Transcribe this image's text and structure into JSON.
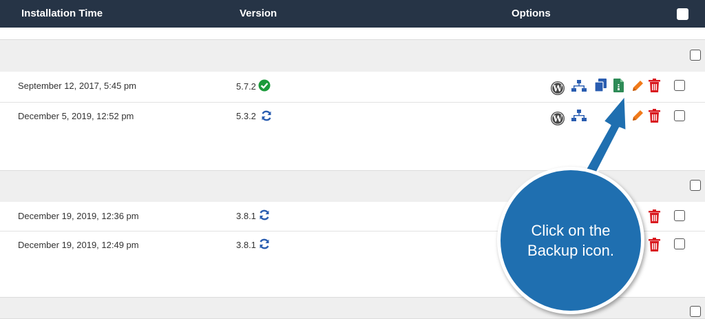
{
  "header": {
    "installation_time": "Installation Time",
    "version": "Version",
    "options": "Options"
  },
  "rows": [
    {
      "time": "September 12, 2017, 5:45 pm",
      "version": "5.7.2",
      "status_icon": "check-circle-icon"
    },
    {
      "time": "December 5, 2019, 12:52 pm",
      "version": "5.3.2",
      "status_icon": "refresh-icon"
    },
    {
      "time": "December 19, 2019, 12:36 pm",
      "version": "3.8.1",
      "status_icon": "refresh-icon"
    },
    {
      "time": "December 19, 2019, 12:49 pm",
      "version": "3.8.1",
      "status_icon": "refresh-icon"
    }
  ],
  "option_icons": [
    "wordpress-icon",
    "sitemap-icon",
    "clone-icon",
    "backup-icon",
    "edit-pencil-icon",
    "trash-icon"
  ],
  "callout": {
    "line1": "Click on the",
    "line2": "Backup icon."
  },
  "colors": {
    "header_bg": "#263446",
    "group_bg": "#efefef",
    "accent_blue": "#1f6fb0",
    "icon_blue": "#2a5db0",
    "check_green": "#1a9a3a",
    "backup_green": "#2e8b57",
    "pencil_orange": "#f07a1a",
    "trash_red": "#d9191f"
  }
}
